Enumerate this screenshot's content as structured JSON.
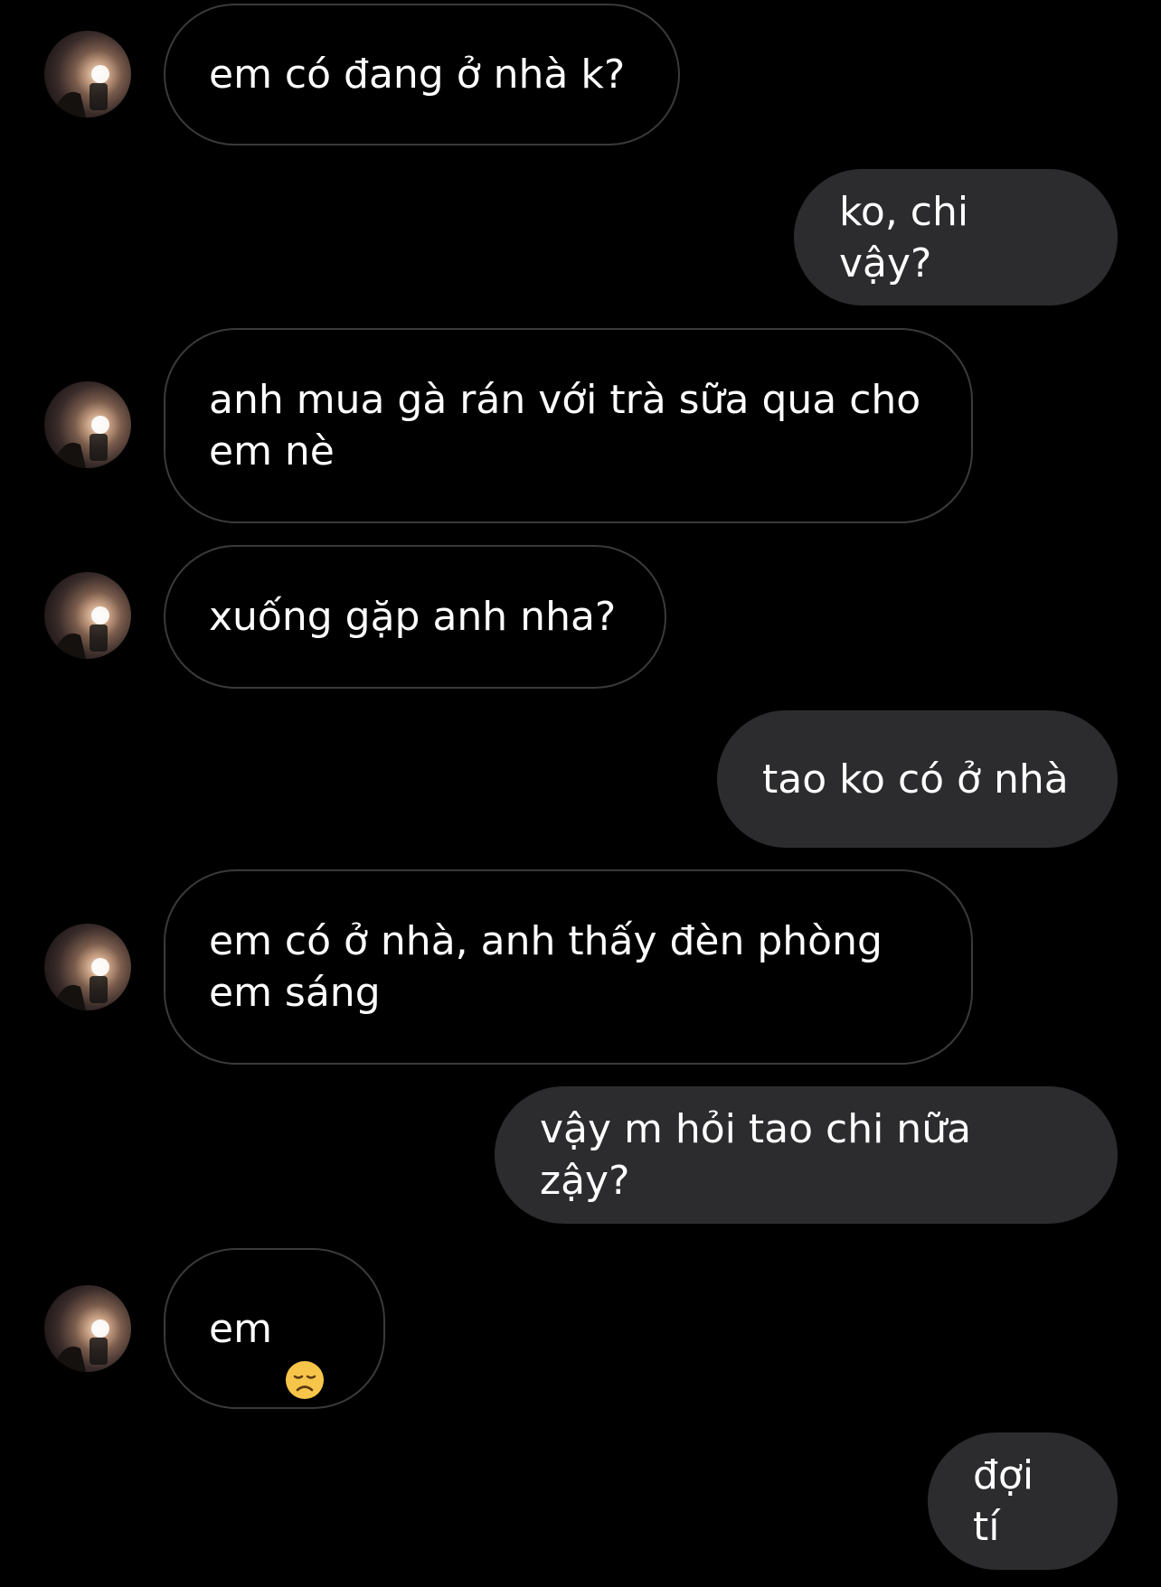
{
  "theme": {
    "background": "#000000",
    "incoming_border": "#3a3a3c",
    "outgoing_fill": "#2c2c2e",
    "text": "#ffffff",
    "emoji_color": "#f6c54a"
  },
  "messages": [
    {
      "side": "in",
      "text": "em có đang ở nhà k?"
    },
    {
      "side": "out",
      "text": "ko, chi vậy?"
    },
    {
      "side": "in",
      "text": "anh mua gà rán với trà sữa qua cho em nè"
    },
    {
      "side": "in",
      "text": "xuống gặp anh nha?"
    },
    {
      "side": "out",
      "text": "tao ko có ở nhà"
    },
    {
      "side": "in",
      "text": "em có ở nhà, anh thấy đèn phòng em sáng"
    },
    {
      "side": "out",
      "text": "vậy m hỏi tao chi nữa zậy?"
    },
    {
      "side": "in",
      "text": "em",
      "emoji": "disappointed-face-emoji"
    },
    {
      "side": "out",
      "text": "đợi tí"
    }
  ]
}
